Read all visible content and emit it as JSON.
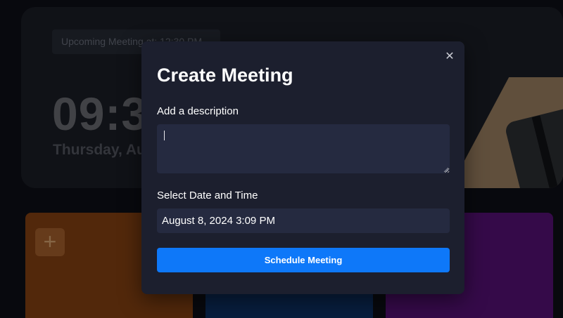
{
  "background": {
    "upcoming_meeting": "Upcoming Meeting at: 12:30 PM",
    "clock_time": "09:3",
    "clock_date": "Thursday, Au",
    "cards": [
      {
        "color": "#5e2e0d",
        "icon": "plus-icon",
        "icon_glyph": "+"
      },
      {
        "color": "#0a2347"
      },
      {
        "color": "#3d0c54"
      }
    ]
  },
  "modal": {
    "title": "Create Meeting",
    "close_glyph": "✕",
    "description_label": "Add a description",
    "description_value": "",
    "date_time_label": "Select Date and Time",
    "date_time_value": "August 8, 2024 3:09 PM",
    "submit_label": "Schedule Meeting"
  },
  "colors": {
    "modal_bg": "#1c1f2e",
    "input_bg": "#252a40",
    "accent": "#0e78f9"
  }
}
